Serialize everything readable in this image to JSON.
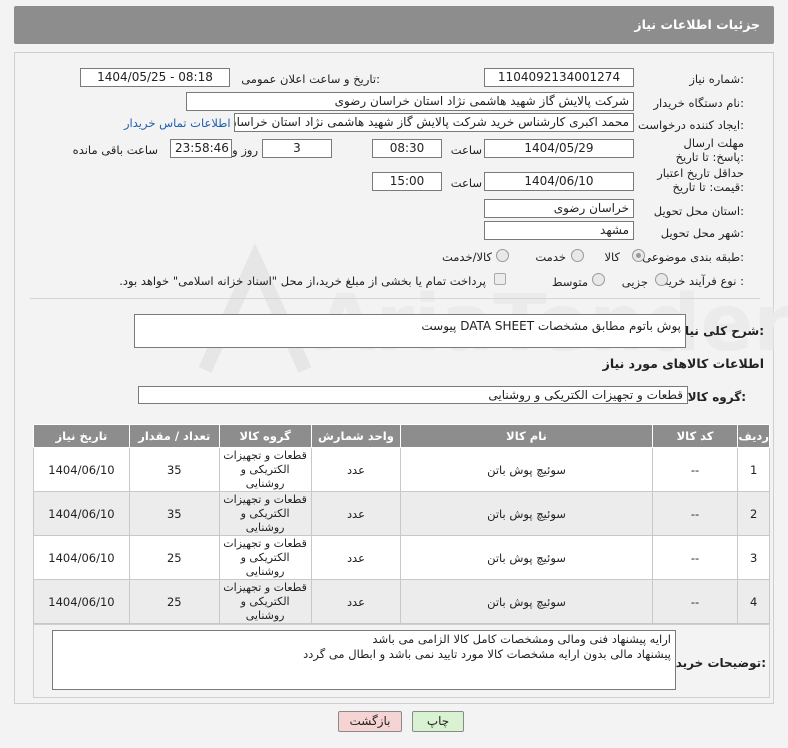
{
  "header": {
    "title": "جزئیات اطلاعات نیاز"
  },
  "form": {
    "need_number_label": "شماره نیاز:",
    "need_number": "1104092134001274",
    "announce_label": "تاریخ و ساعت اعلان عمومی:",
    "announce_value": "1404/05/25 - 08:18",
    "buyer_label": "نام دستگاه خریدار:",
    "buyer_value": "شرکت پالایش گاز شهید هاشمی نژاد   استان خراسان رضوی",
    "creator_label": "ایجاد کننده درخواست:",
    "creator_value": "محمد اکبری کارشناس خرید شرکت پالایش گاز شهید هاشمی نژاد   استان خراسان",
    "contact_link": "اطلاعات تماس خریدار",
    "deadline_label": "مهلت ارسال پاسخ: تا تاریخ:",
    "deadline_date": "1404/05/29",
    "time_label": "ساعت",
    "deadline_time": "08:30",
    "days_value": "3",
    "days_label": "روز و",
    "remaining_value": "23:58:46",
    "remaining_label": "ساعت باقی مانده",
    "price_label": "حداقل تاریخ اعتبار قیمت: تا تاریخ:",
    "price_date": "1404/06/10",
    "price_time": "15:00",
    "province_label": "استان محل تحویل:",
    "province_value": "خراسان رضوی",
    "city_label": "شهر محل تحویل:",
    "city_value": "مشهد",
    "category_label": "طبقه بندی موضوعی:",
    "category_options": [
      "کالا",
      "خدمت",
      "کالا/خدمت"
    ],
    "process_label": "نوع فرآیند خرید :",
    "process_options": [
      "جزیی",
      "متوسط"
    ],
    "payment_text": "پرداخت تمام یا بخشی از مبلغ خرید،از محل \"اسناد خزانه اسلامی\" خواهد بود."
  },
  "description": {
    "label": "شرح کلی نیاز:",
    "value": "پوش باتوم مطابق مشخصات DATA SHEET پیوست"
  },
  "goods_section": {
    "title": "اطلاعات کالاهای مورد نیاز"
  },
  "goods_group": {
    "label": "گروه کالا:",
    "value": "قطعات و تجهیزات الکتریکی و روشنایی"
  },
  "table": {
    "headers": [
      "ردیف",
      "کد کالا",
      "نام کالا",
      "واحد شمارش",
      "گروه کالا",
      "تعداد / مقدار",
      "تاریخ نیاز"
    ],
    "rows": [
      {
        "row": "1",
        "code": "--",
        "name": "سوئیچ پوش باتن",
        "unit": "عدد",
        "group": "قطعات و تجهیزات الکتریکی و روشنایی",
        "qty": "35",
        "date": "1404/06/10"
      },
      {
        "row": "2",
        "code": "--",
        "name": "سوئیچ پوش باتن",
        "unit": "عدد",
        "group": "قطعات و تجهیزات الکتریکی و روشنایی",
        "qty": "35",
        "date": "1404/06/10"
      },
      {
        "row": "3",
        "code": "--",
        "name": "سوئیچ پوش باتن",
        "unit": "عدد",
        "group": "قطعات و تجهیزات الکتریکی و روشنایی",
        "qty": "25",
        "date": "1404/06/10"
      },
      {
        "row": "4",
        "code": "--",
        "name": "سوئیچ پوش باتن",
        "unit": "عدد",
        "group": "قطعات و تجهیزات الکتریکی و روشنایی",
        "qty": "25",
        "date": "1404/06/10"
      }
    ]
  },
  "buyer_notes": {
    "label": "توضیحات خریدار:",
    "line1": "ارایه پیشنهاد فنی ومالی ومشخصات کامل کالا الزامی می باشد",
    "line2": "پیشنهاد مالی بدون ارایه مشخصات کالا مورد تایید نمی باشد و ابطال می گردد"
  },
  "buttons": {
    "print": "چاپ",
    "back": "بازگشت"
  },
  "watermark": "AriaTender.neT",
  "colors": {
    "header_bg": "#8d8d8d",
    "link": "#1f5fb0",
    "print_bg": "#d9f2d2",
    "back_bg": "#f6d4d4"
  }
}
